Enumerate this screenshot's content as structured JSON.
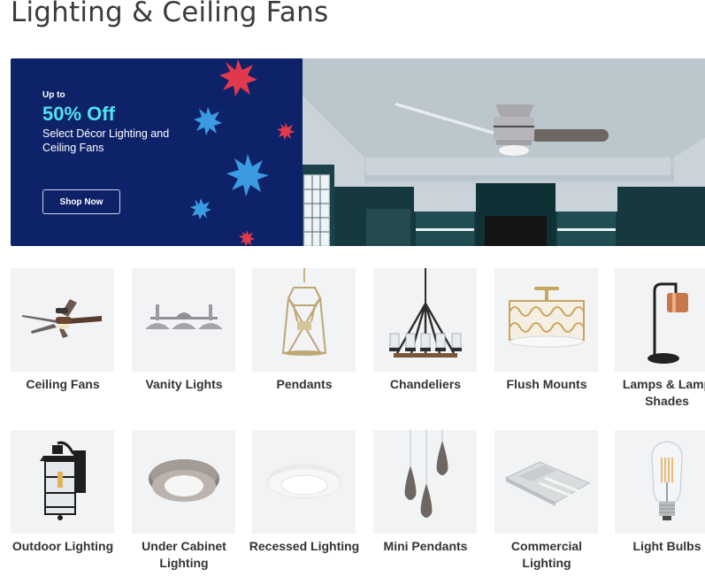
{
  "page": {
    "title": "Lighting & Ceiling Fans"
  },
  "hero": {
    "eyebrow": "Up to",
    "headline": "50% Off",
    "subheadline": "Select Décor Lighting and Ceiling Fans",
    "cta_label": "Shop Now",
    "colors": {
      "panel_bg": "#0e2269",
      "headline": "#4fe3f2",
      "star_red": "#e2384d",
      "star_blue": "#3a9be0"
    },
    "image": "ceiling-fan-living-room-photo"
  },
  "categories": [
    {
      "label": "Ceiling Fans",
      "icon": "ceiling-fan-icon"
    },
    {
      "label": "Vanity Lights",
      "icon": "vanity-light-icon"
    },
    {
      "label": "Pendants",
      "icon": "pendant-lantern-icon"
    },
    {
      "label": "Chandeliers",
      "icon": "chandelier-icon"
    },
    {
      "label": "Flush Mounts",
      "icon": "flush-mount-icon"
    },
    {
      "label": "Lamps & Lamp Shades",
      "icon": "desk-lamp-icon"
    },
    {
      "label": "Outdoor Lighting",
      "icon": "outdoor-lantern-icon"
    },
    {
      "label": "Under Cabinet Lighting",
      "icon": "puck-light-icon"
    },
    {
      "label": "Recessed Lighting",
      "icon": "recessed-light-icon"
    },
    {
      "label": "Mini Pendants",
      "icon": "mini-pendant-icon"
    },
    {
      "label": "Commercial Lighting",
      "icon": "high-bay-light-icon"
    },
    {
      "label": "Light Bulbs",
      "icon": "light-bulb-icon"
    }
  ]
}
